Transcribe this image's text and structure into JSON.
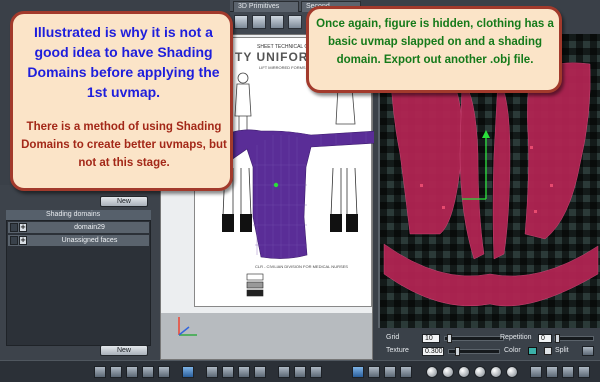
{
  "tabs": {
    "primitives": "3D Primitives",
    "second": "Second"
  },
  "left_panel": {
    "new_button_top": "New",
    "shading_domains_header": "Shading domains",
    "domains": [
      {
        "label": "domain29"
      },
      {
        "label": "Unassigned faces"
      }
    ],
    "new_button_bottom": "New"
  },
  "reference_sheet": {
    "title": "SHEET TECHNICAL ORDER",
    "heading": "TY UNIFORM-FE",
    "subtitle": "LIFT MIRRORED FORMS",
    "footer": "CLR - CIVILIAN DIVISION FOR MEDICAL NURSES"
  },
  "uv_controls": {
    "grid_label": "Grid",
    "grid_value": "10",
    "texture_label": "Texture",
    "texture_value": "0.300",
    "repetition_label": "Repetition",
    "repetition_value": "0",
    "color_label": "Color",
    "split_label": "Split",
    "colors": {
      "color_swatch": "#3bb0a8"
    }
  },
  "callouts": {
    "left_title": "Illustrated is why it is not a good idea to have Shading Domains before applying the 1st uvmap.",
    "left_body": "There is a method of using Shading Domains to create better uvmaps, but not at this stage.",
    "right_body": "Once again, figure is hidden, clothing has a basic uvmap slapped on and a shading domain. Export out another .obj file."
  },
  "colors": {
    "callout_bg": "#fbe4c8",
    "callout_border": "#a23a2c",
    "left_title_color": "#1e1edc",
    "left_body_color": "#a32818",
    "right_body_color": "#157a1a",
    "uv_mesh": "#b02452",
    "garment": "#5a2d97"
  },
  "icons": [
    "cube-icon",
    "sphere-icon",
    "move-tool-icon",
    "rotate-tool-icon",
    "scale-tool-icon",
    "camera-icon",
    "eye-icon",
    "plus-icon"
  ]
}
